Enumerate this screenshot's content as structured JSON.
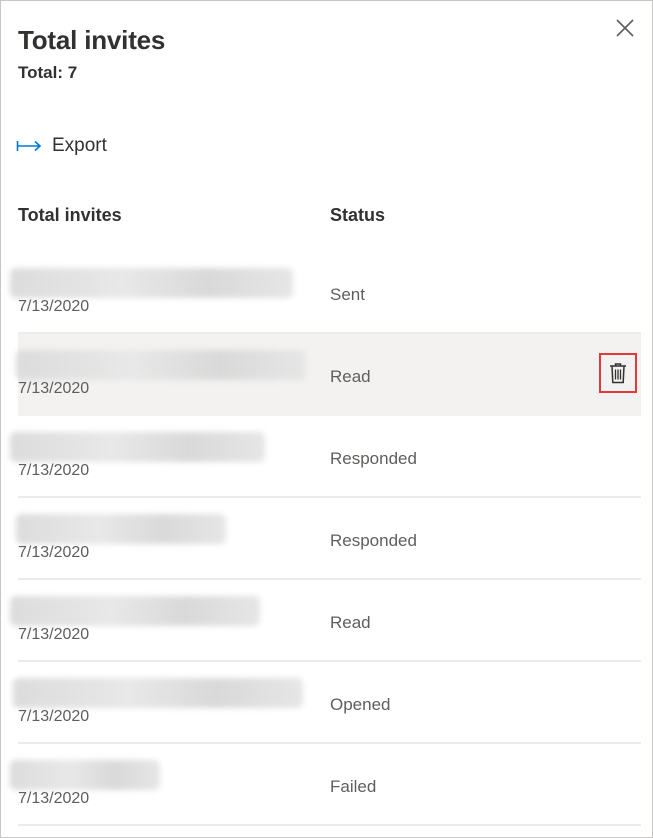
{
  "panel": {
    "title": "Total invites",
    "total_text": "Total: 7",
    "export_label": "Export"
  },
  "table": {
    "headers": [
      "Total invites",
      "Status"
    ],
    "rows": [
      {
        "date": "7/13/2020",
        "status": "Sent"
      },
      {
        "date": "7/13/2020",
        "status": "Read"
      },
      {
        "date": "7/13/2020",
        "status": "Responded"
      },
      {
        "date": "7/13/2020",
        "status": "Responded"
      },
      {
        "date": "7/13/2020",
        "status": "Read"
      },
      {
        "date": "7/13/2020",
        "status": "Opened"
      },
      {
        "date": "7/13/2020",
        "status": "Failed"
      }
    ]
  },
  "icons": {
    "close": "close-icon",
    "export": "export-arrow-icon",
    "delete": "trash-icon"
  },
  "colors": {
    "accent": "#0078d4",
    "highlight_border": "#e03a3a",
    "row_hover": "#f3f2f1"
  }
}
